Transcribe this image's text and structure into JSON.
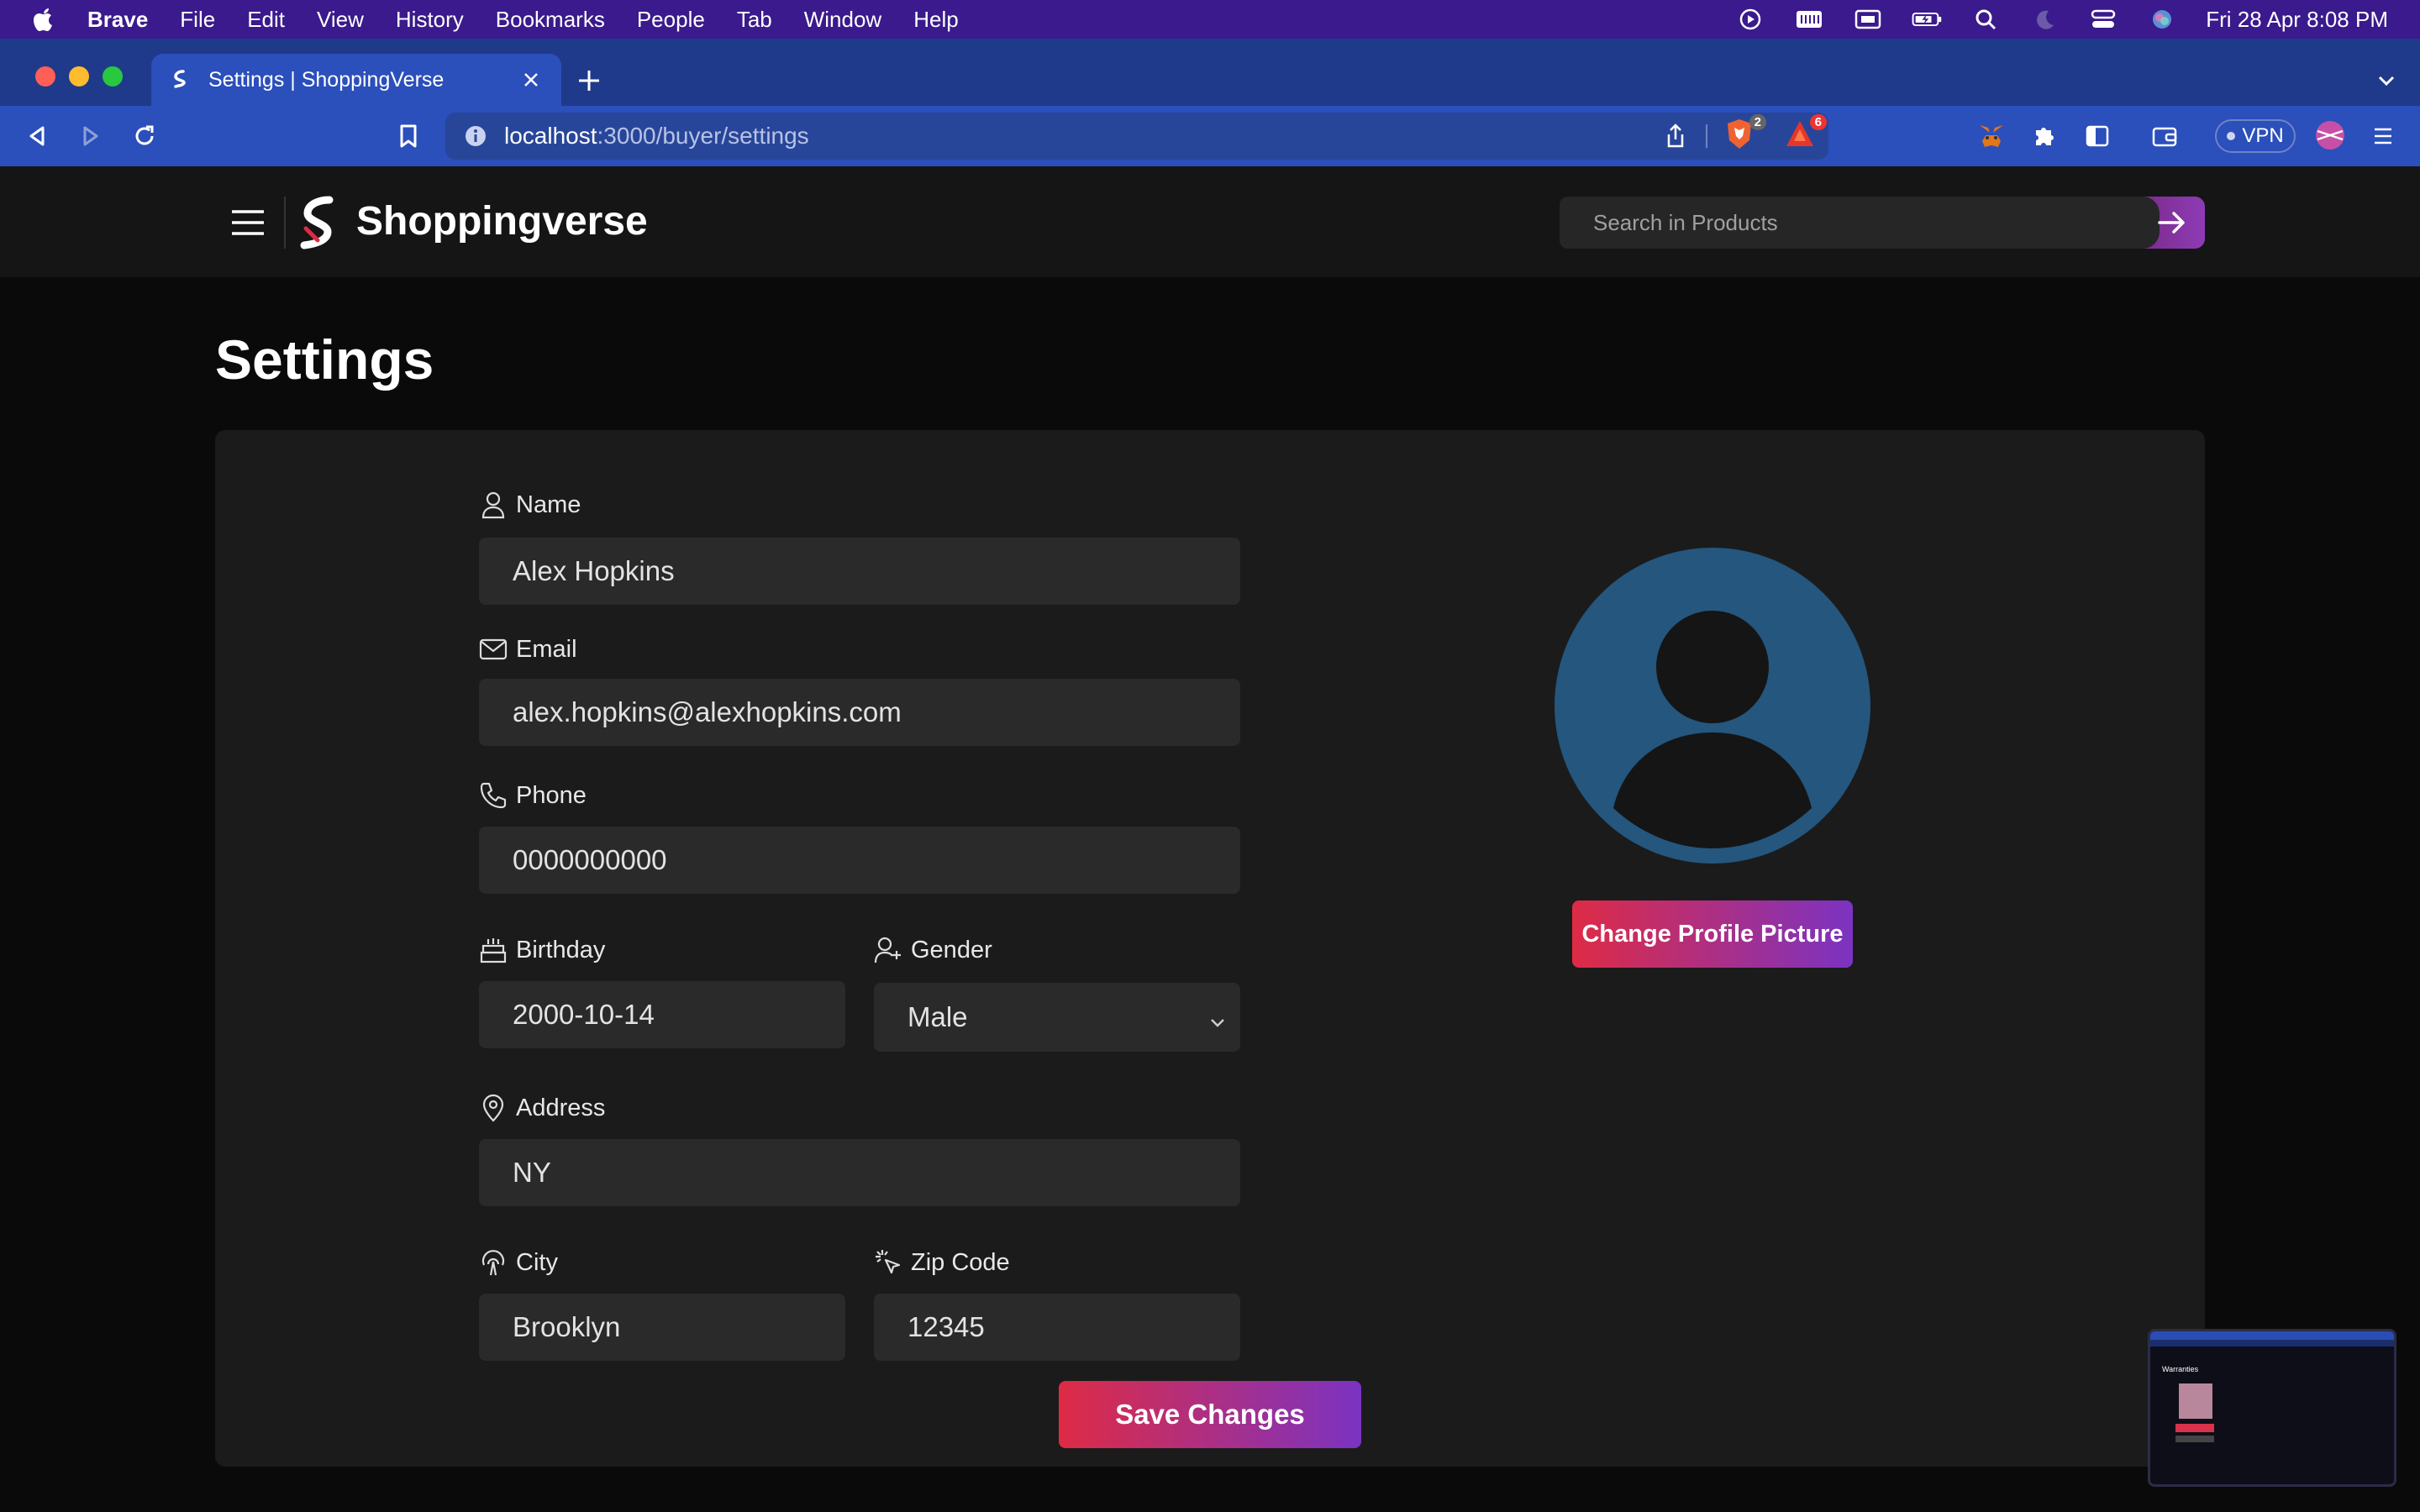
{
  "menubar": {
    "app": "Brave",
    "items": [
      "File",
      "Edit",
      "View",
      "History",
      "Bookmarks",
      "People",
      "Tab",
      "Window",
      "Help"
    ],
    "datetime": "Fri 28 Apr  8:08 PM"
  },
  "browser": {
    "tab_title": "Settings | ShoppingVerse",
    "url_host": "localhost",
    "url_path": ":3000/buyer/settings",
    "shields_count": "2",
    "rewards_count": "6",
    "vpn_label": "VPN"
  },
  "header": {
    "brand": "Shoppingverse",
    "search_placeholder": "Search in Products"
  },
  "page": {
    "title": "Settings"
  },
  "form": {
    "name_label": "Name",
    "name_value": "Alex Hopkins",
    "email_label": "Email",
    "email_value": "alex.hopkins@alexhopkins.com",
    "phone_label": "Phone",
    "phone_value": "0000000000",
    "birthday_label": "Birthday",
    "birthday_value": "2000-10-14",
    "gender_label": "Gender",
    "gender_value": "Male",
    "address_label": "Address",
    "address_value": "NY",
    "city_label": "City",
    "city_value": "Brooklyn",
    "zip_label": "Zip Code",
    "zip_value": "12345",
    "save_label": "Save Changes"
  },
  "profile": {
    "change_picture_label": "Change Profile Picture"
  },
  "colors": {
    "accent_start": "#de2b45",
    "accent_end": "#7b33c2",
    "avatar": "#24567e",
    "card": "#1b1b1b",
    "field": "#2a2a2a"
  },
  "pip": {
    "title": "Warranties"
  }
}
